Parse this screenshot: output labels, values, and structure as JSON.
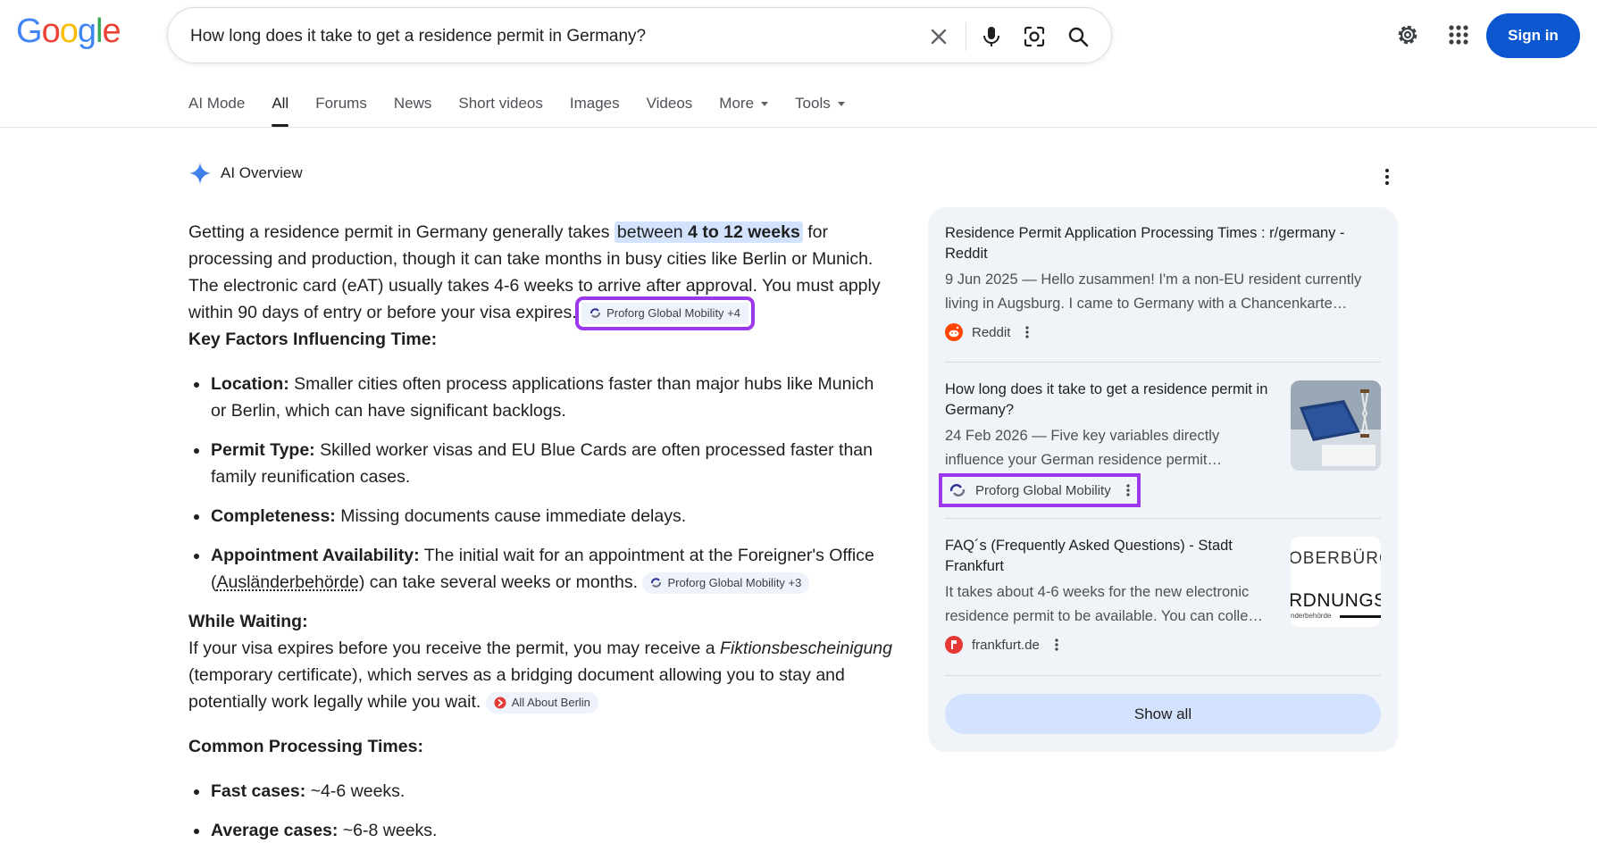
{
  "header": {
    "logo_letters": [
      "G",
      "o",
      "o",
      "g",
      "l",
      "e"
    ],
    "logo_colors": [
      "#4285F4",
      "#EA4335",
      "#FBBC05",
      "#4285F4",
      "#34A853",
      "#EA4335"
    ],
    "query": "How long does it take to get a residence permit in Germany?",
    "sign_in_label": "Sign in",
    "icons": [
      "clear-icon",
      "mic-icon",
      "lens-icon",
      "search-icon",
      "settings-icon",
      "apps-icon"
    ]
  },
  "tabs": [
    {
      "label": "AI Mode"
    },
    {
      "label": "All"
    },
    {
      "label": "Forums"
    },
    {
      "label": "News"
    },
    {
      "label": "Short videos"
    },
    {
      "label": "Images"
    },
    {
      "label": "Videos"
    },
    {
      "label": "More"
    },
    {
      "label": "Tools"
    }
  ],
  "active_tab": "All",
  "overview": {
    "title": "AI Overview",
    "intro_a": "Getting a residence permit in Germany generally takes ",
    "intro_hl_a": "between ",
    "intro_hl_b": "4 to 12 weeks",
    "intro_b": " for processing and production, though it can take months in busy cities like Berlin or Munich. The electronic card (eAT) usually takes 4-6 weeks to arrive after approval. You must apply within 90 days of entry or before your visa expires.",
    "chip1": "Proforg Global Mobility +4",
    "key_heading": "Key Factors Influencing Time:",
    "factors": [
      {
        "bold": "Location:",
        "text": " Smaller cities often process applications faster than major hubs like Munich or Berlin, which can have significant backlogs."
      },
      {
        "bold": "Permit Type:",
        "text": " Skilled worker visas and EU Blue Cards are often processed faster than family reunification cases."
      },
      {
        "bold": "Completeness:",
        "text": " Missing documents cause immediate delays."
      },
      {
        "bold": "Appointment Availability:",
        "text_a": " The initial wait for an appointment at the Foreigner's Office (",
        "text_u": "Ausländerbehörde",
        "text_b": ") can take several weeks or months. "
      }
    ],
    "chip2": "Proforg Global Mobility +3",
    "waiting_heading": "While Waiting:",
    "waiting_a": "If your visa expires before you receive the permit, you may receive a ",
    "waiting_italic": "Fiktionsbescheinigung",
    "waiting_b": " (temporary certificate), which serves as a bridging document allowing you to stay and potentially work legally while you wait. ",
    "chip3": "All About Berlin",
    "common_heading": "Common Processing Times:",
    "times": [
      {
        "bold": "Fast cases:",
        "text": " ~4-6 weeks."
      },
      {
        "bold": "Average cases:",
        "text": " ~6-8 weeks."
      }
    ]
  },
  "sources": [
    {
      "title": "Residence Permit Application Processing Times : r/germany - Reddit",
      "snippet": "9 Jun 2025 — Hello zusammen! I'm a non-EU resident currently living in Augsburg. I came to Germany with a Chancenkarte…",
      "site": "Reddit"
    },
    {
      "title": "How long does it take to get a residence permit in Germany?",
      "snippet": "24 Feb 2026 — Five key variables directly influence your German residence permit…",
      "site": "Proforg Global Mobility"
    },
    {
      "title": "FAQ´s (Frequently Asked Questions) - Stadt Frankfurt",
      "snippet": "It takes about 4-6 weeks for the new electronic residence permit to be available. You can colle…",
      "site": "frankfurt.de",
      "thumb_text_a": "OBERBÜRGE",
      "thumb_text_b": "RDNUNGSA",
      "thumb_text_c": "nderbehörde"
    }
  ],
  "show_all_label": "Show all",
  "colors": {
    "accent": "#0b57d0",
    "highlight": "#d3e3fd",
    "card_bg": "#f0f4f9",
    "annotation": "#9b38ec"
  }
}
